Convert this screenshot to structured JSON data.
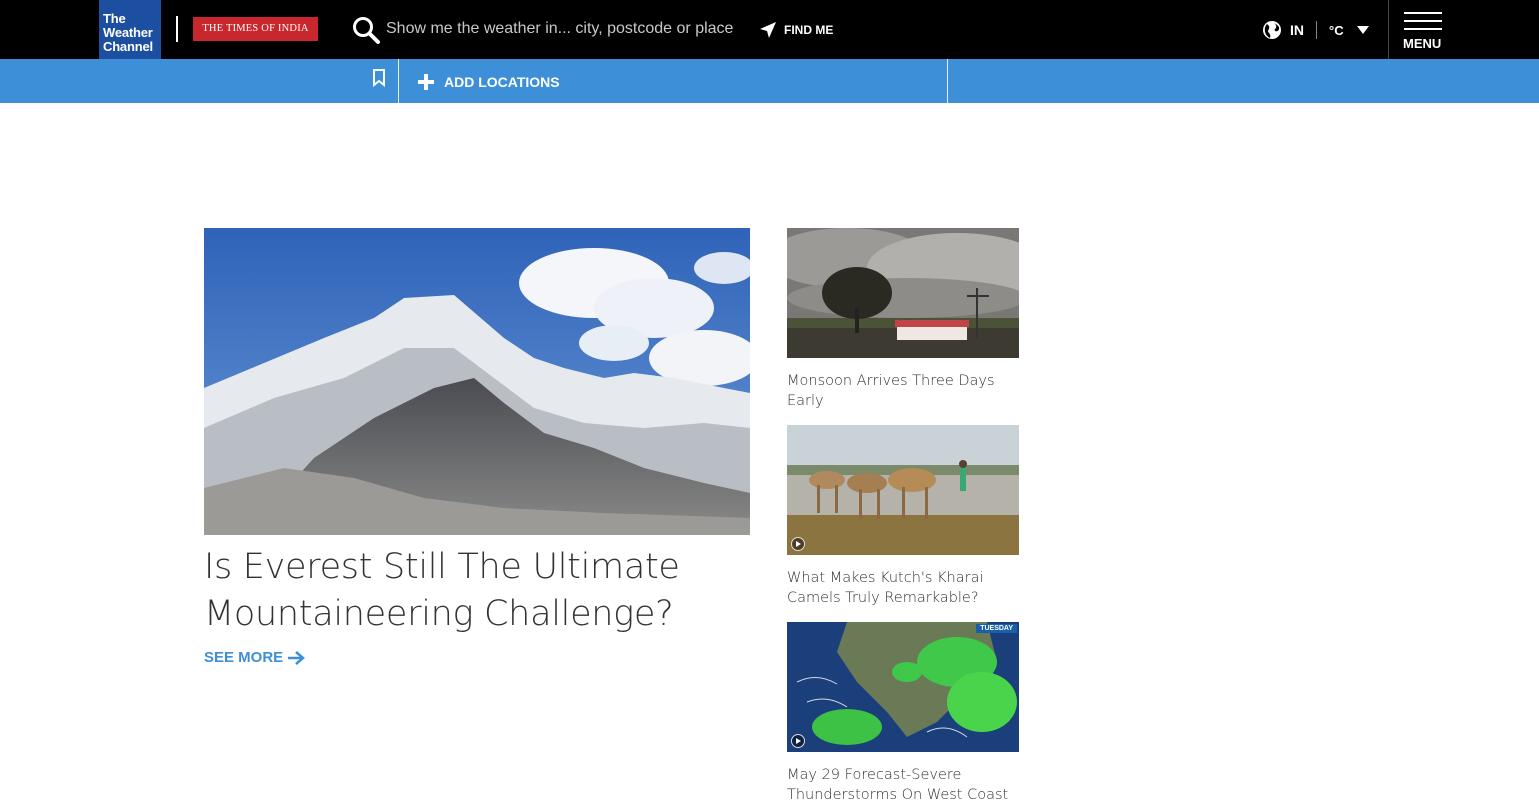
{
  "header": {
    "twc_logo_lines": [
      "The",
      "Weather",
      "Channel"
    ],
    "toi_logo": "THE TIMES OF INDIA",
    "search": {
      "placeholder": "Show me the weather in... city, postcode or place"
    },
    "find_me_label": "FIND ME",
    "region": "IN",
    "unit": "°C",
    "menu_label": "MENU"
  },
  "locations_bar": {
    "add_label": "ADD LOCATIONS"
  },
  "hero": {
    "title": "Is Everest Still The Ultimate Mountaineering Challenge?",
    "see_more": "SEE MORE"
  },
  "stories": [
    {
      "title": "Monsoon Arrives Three Days Early",
      "video": false
    },
    {
      "title": "What Makes Kutch's Kharai Camels Truly Remarkable?",
      "video": true
    },
    {
      "title": "May 29 Forecast-Severe Thunderstorms On West Coast",
      "video": true,
      "badge": "TUESDAY"
    }
  ],
  "colors": {
    "topbar": "#000000",
    "accent_blue": "#3d8fd8",
    "twc_blue": "#1c4fa0",
    "toi_red": "#c8282d"
  }
}
